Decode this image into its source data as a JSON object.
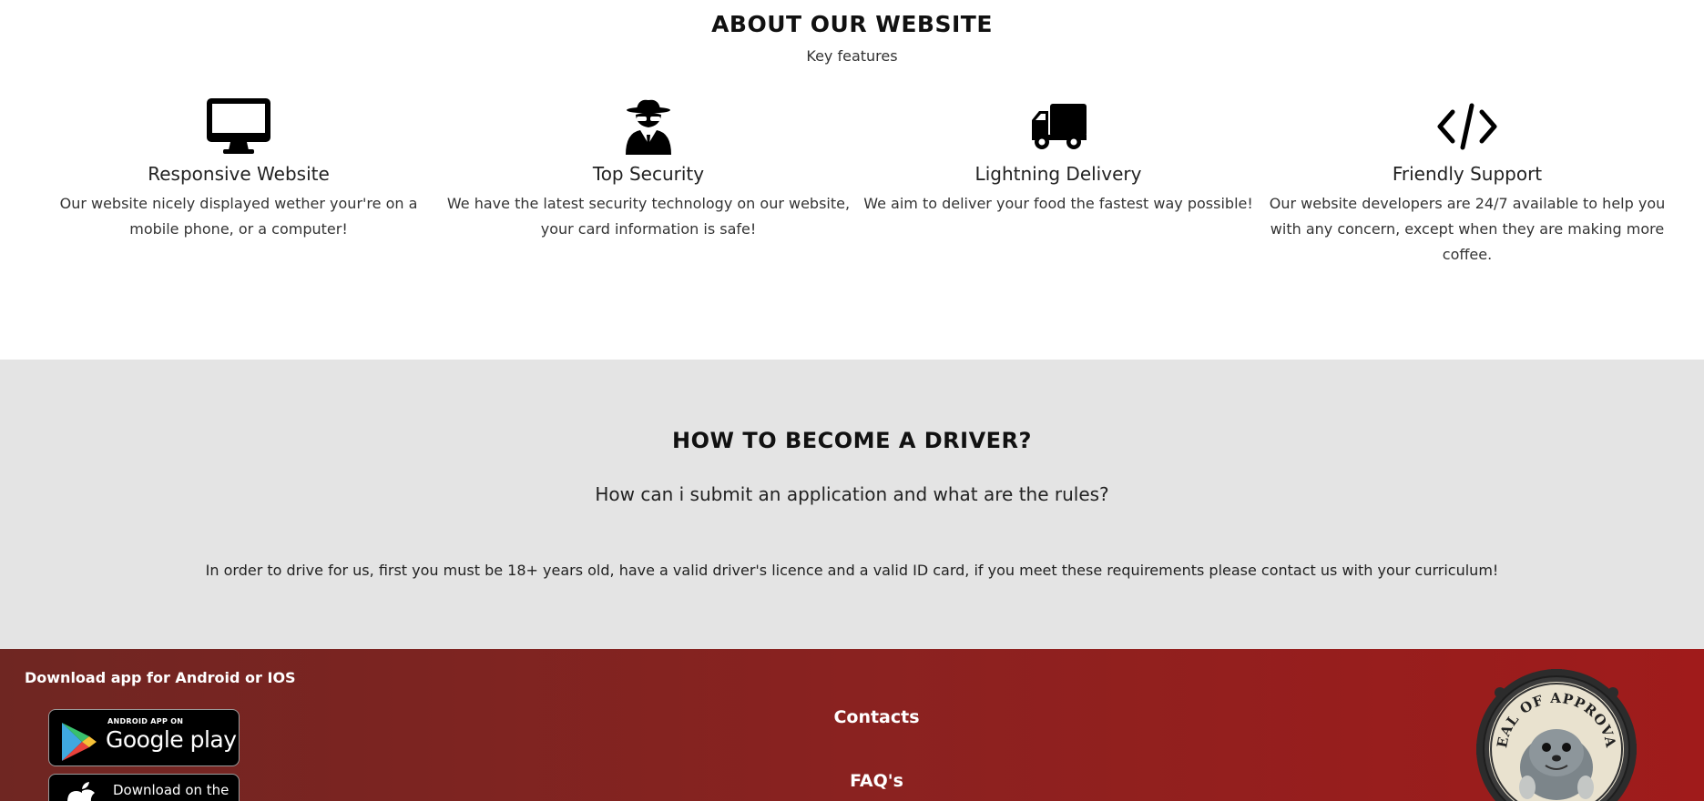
{
  "about": {
    "title": "ABOUT OUR WEBSITE",
    "subtitle": "Key features",
    "features": [
      {
        "icon": "desktop-icon",
        "title": "Responsive Website",
        "description": "Our website nicely displayed wether your're on a mobile phone, or a computer!"
      },
      {
        "icon": "spy-icon",
        "title": "Top Security",
        "description": "We have the latest security technology on our website, your card information is safe!"
      },
      {
        "icon": "truck-icon",
        "title": "Lightning Delivery",
        "description": "We aim to deliver your food the fastest way possible!"
      },
      {
        "icon": "code-icon",
        "title": "Friendly Support",
        "description": "Our website developers are 24/7 available to help you with any concern, except when they are making more coffee."
      }
    ]
  },
  "driver": {
    "title": "HOW TO BECOME A DRIVER?",
    "question": "How can i submit an application and what are the rules?",
    "body": "In order to drive for us, first you must be 18+ years old, have a valid driver's licence and a valid ID card, if you meet these requirements please contact us with your curriculum!"
  },
  "footer": {
    "download_label": "Download app for Android or IOS",
    "google_play": {
      "small": "ANDROID APP ON",
      "big": "Google play"
    },
    "app_store": {
      "text": "Download on the"
    },
    "links": {
      "contacts": "Contacts",
      "faq": "FAQ's"
    },
    "seal": {
      "text": "SEAL OF APPROVAL"
    }
  },
  "colors": {
    "driver_bg": "#e4e4e4",
    "footer_start": "#6f2622",
    "footer_end": "#a01b1b"
  }
}
